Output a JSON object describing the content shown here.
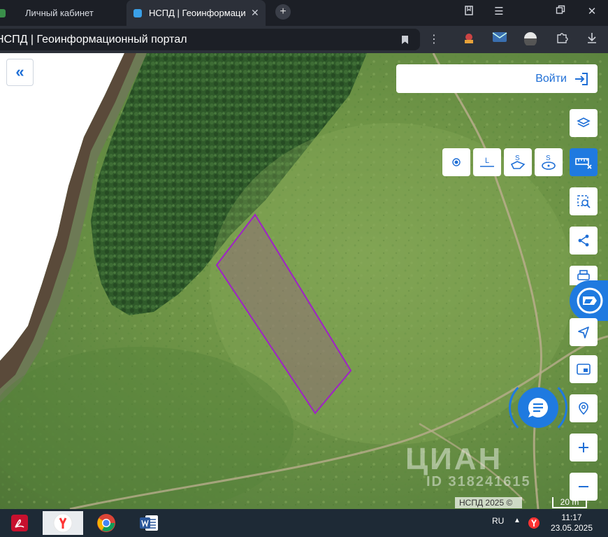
{
  "browser": {
    "tabs": [
      {
        "title": "Личный кабинет"
      },
      {
        "title": "НСПД | Геоинформаци",
        "close": "✕"
      }
    ],
    "new_tab": "+",
    "address_title": "НСПД | Геоинформационный портал"
  },
  "map": {
    "login_label": "Войти",
    "attribution": "НСПД 2025 ©",
    "scale_label": "20 m",
    "watermark": "ЦИАН",
    "watermark_id": "ID 318241615",
    "parcel_color": "#a020c8",
    "accent_color": "#1f7ae0"
  },
  "measure_tools": [
    {
      "icon": "point-measure-icon"
    },
    {
      "icon": "line-measure-icon",
      "glyph": "L"
    },
    {
      "icon": "area-polygon-measure-icon",
      "glyph": "S"
    },
    {
      "icon": "area-circle-measure-icon",
      "glyph": "S"
    }
  ],
  "taskbar": {
    "language": "RU",
    "time": "11:17",
    "date": "23.05.2025"
  }
}
